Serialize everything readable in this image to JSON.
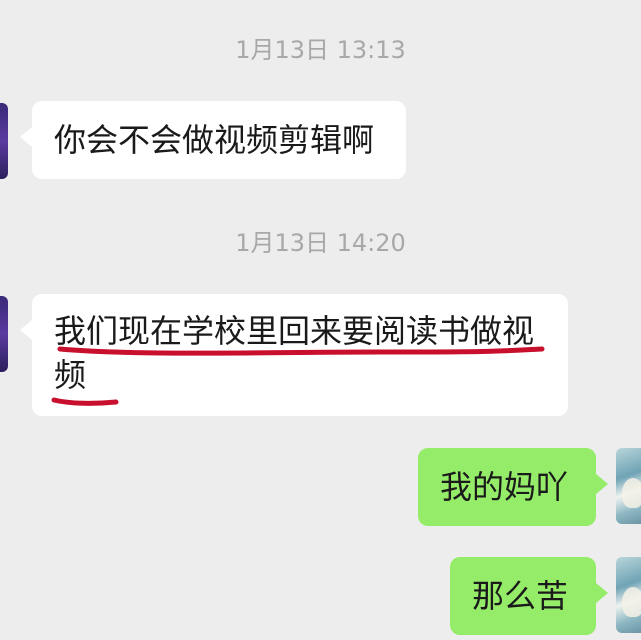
{
  "chat": {
    "messages": [
      {
        "type": "timestamp",
        "text": "1月13日 13:13"
      },
      {
        "type": "message",
        "side": "left",
        "text": "你会不会做视频剪辑啊"
      },
      {
        "type": "timestamp",
        "text": "1月13日 14:20"
      },
      {
        "type": "message",
        "side": "left",
        "line1": "我们现在学校里回来要阅读书做视",
        "line2": "频"
      },
      {
        "type": "message",
        "side": "right",
        "text": "我的妈吖"
      },
      {
        "type": "message",
        "side": "right",
        "text": "那么苦"
      }
    ]
  },
  "colors": {
    "background": "#ededed",
    "incoming_bubble": "#ffffff",
    "outgoing_bubble": "#95ec69",
    "timestamp_text": "#a8a8a8",
    "annotation_underline": "#c8102e"
  },
  "icons": {
    "left_avatar": "contact-avatar-icon",
    "right_avatar": "user-avatar-icon"
  }
}
